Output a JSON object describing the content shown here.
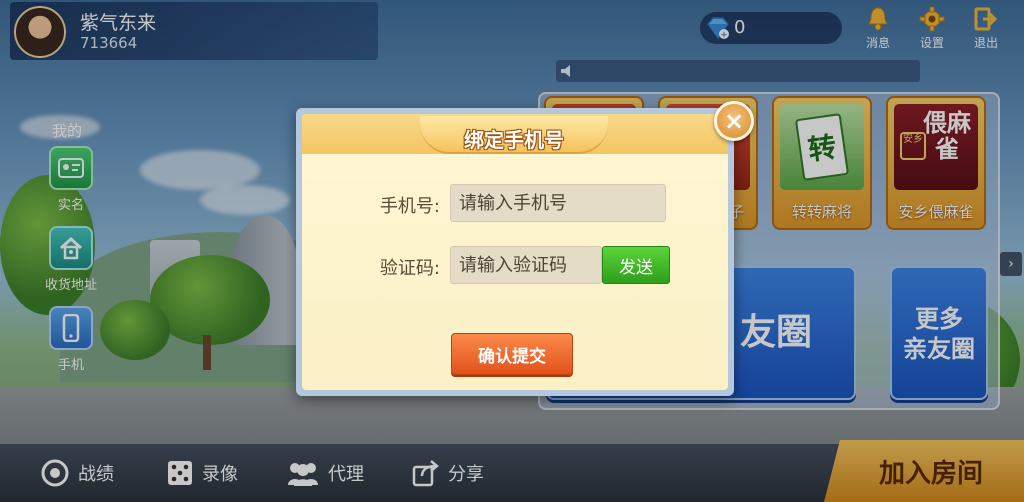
{
  "user": {
    "name": "紫气东来",
    "id": "713664"
  },
  "currency": {
    "count": "0"
  },
  "top_actions": [
    {
      "label": "消息",
      "icon": "bell-icon"
    },
    {
      "label": "设置",
      "icon": "gear-icon"
    },
    {
      "label": "退出",
      "icon": "exit-icon"
    }
  ],
  "side_menu": {
    "title": "我的",
    "items": [
      {
        "label": "实名",
        "icon": "id-card-icon"
      },
      {
        "label": "收货地址",
        "icon": "home-icon"
      },
      {
        "label": "手机",
        "icon": "phone-icon"
      }
    ]
  },
  "games": [
    {
      "label": "子"
    },
    {
      "label": "转转麻将"
    },
    {
      "label": "安乡偎麻雀"
    }
  ],
  "tile_art": {
    "zhuan": "转",
    "anxiang": "安乡",
    "weimaque": "偎麻雀"
  },
  "panel_buttons": {
    "friends_partial": "友圈",
    "more_friends_line1": "更多",
    "more_friends_line2": "亲友圈"
  },
  "bottom_bar": {
    "items": [
      {
        "label": "战绩",
        "icon": "record-icon"
      },
      {
        "label": "录像",
        "icon": "dice-icon"
      },
      {
        "label": "代理",
        "icon": "people-icon"
      },
      {
        "label": "分享",
        "icon": "share-icon"
      }
    ],
    "join_room": "加入房间"
  },
  "dialog": {
    "title": "绑定手机号",
    "phone_label": "手机号:",
    "phone_placeholder": "请输入手机号",
    "code_label": "验证码:",
    "code_placeholder": "请输入验证码",
    "send_label": "发送",
    "submit_label": "确认提交",
    "close_glyph": "×"
  },
  "colors": {
    "dialog_bg": "#fbf0c6",
    "title_plate": "#f6c25b",
    "send_green": "#2f9e1c",
    "submit_orange": "#e2521b",
    "panel_blue": "#1c56c2"
  }
}
